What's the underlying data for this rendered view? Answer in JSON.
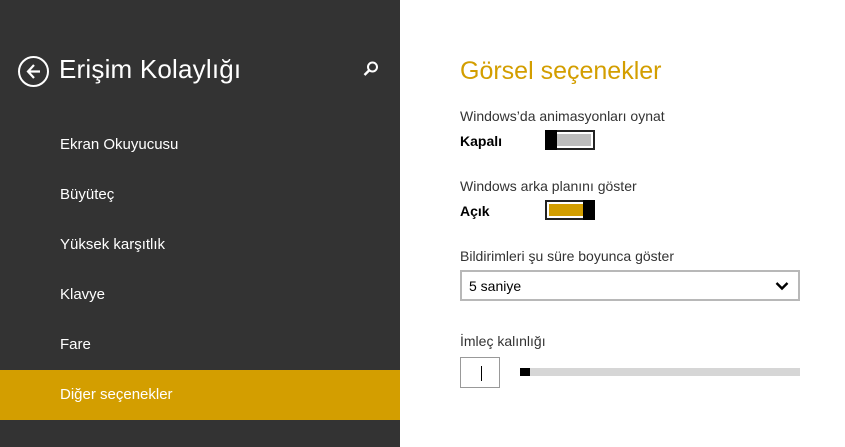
{
  "colors": {
    "accent": "#d39e00",
    "sidebar_bg": "#333333"
  },
  "sidebar": {
    "title": "Erişim Kolaylığı",
    "back_icon": "back-arrow-icon",
    "search_icon": "search-icon",
    "items": [
      {
        "label": "Ekran Okuyucusu",
        "active": false
      },
      {
        "label": "Büyüteç",
        "active": false
      },
      {
        "label": "Yüksek karşıtlık",
        "active": false
      },
      {
        "label": "Klavye",
        "active": false
      },
      {
        "label": "Fare",
        "active": false
      },
      {
        "label": "Diğer seçenekler",
        "active": true
      }
    ]
  },
  "main": {
    "title": "Görsel seçenekler",
    "animations": {
      "label": "Windows’da animasyonları oynat",
      "state": "Kapalı",
      "on": false
    },
    "background": {
      "label": "Windows arka planını göster",
      "state": "Açık",
      "on": true
    },
    "notifications": {
      "label": "Bildirimleri şu süre boyunca göster",
      "value": "5 saniye"
    },
    "cursor": {
      "label": "İmleç kalınlığı",
      "value_fraction": 0.0
    }
  }
}
